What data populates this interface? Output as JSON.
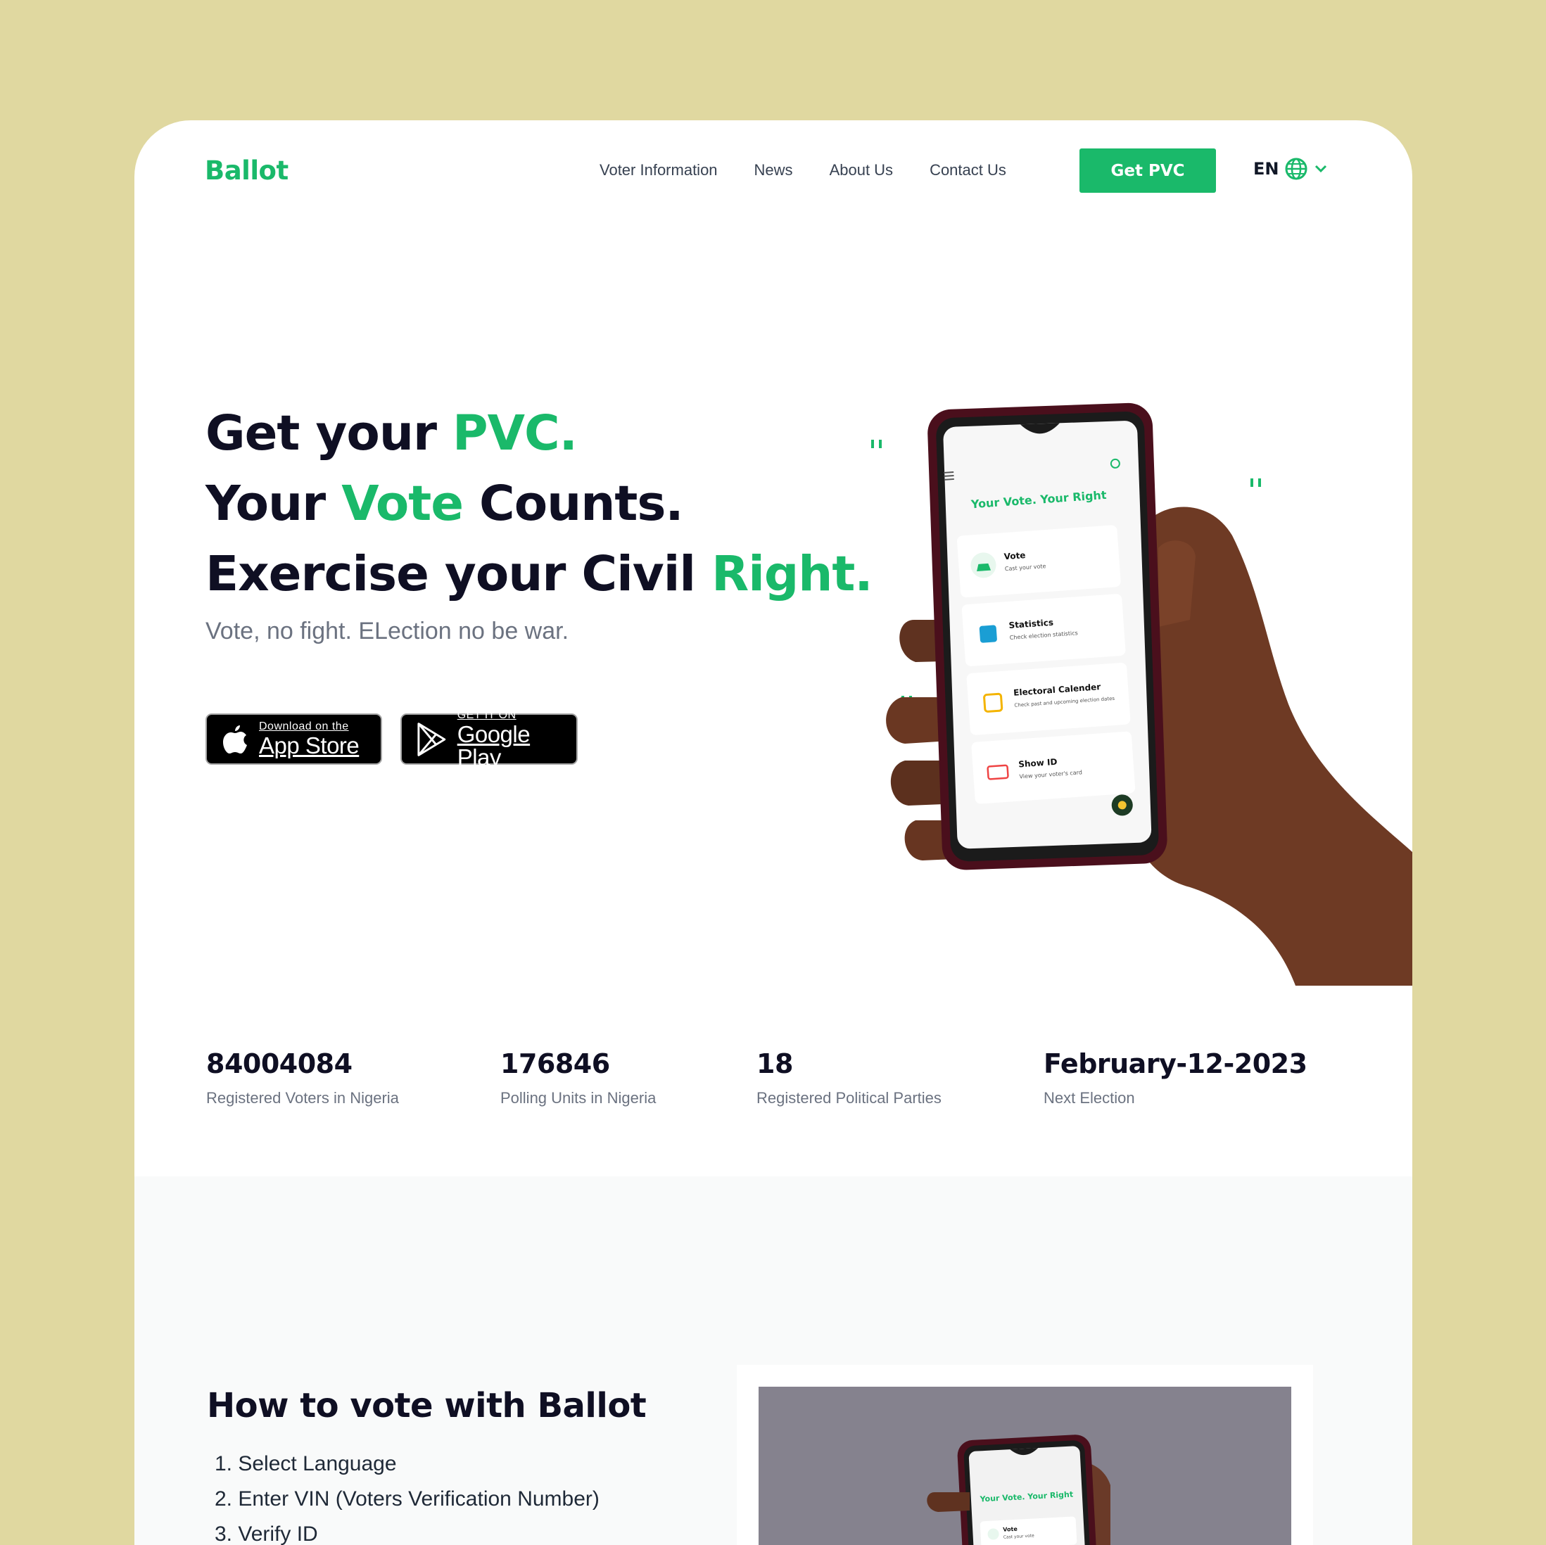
{
  "brand": {
    "name": "Ballot",
    "accent": "#1ab96a",
    "background": "#e0d8a0"
  },
  "nav": {
    "links": [
      "Voter Information",
      "News",
      "About Us",
      "Contact Us"
    ],
    "cta": "Get PVC",
    "language": "EN",
    "language_icon": "globe-icon",
    "dropdown_icon": "chevron-down-icon"
  },
  "hero": {
    "line1": {
      "pre": "Get your ",
      "accent": "PVC."
    },
    "line2": {
      "pre": "Your ",
      "accent": "Vote",
      "post": " Counts."
    },
    "line3": {
      "pre": "Exercise your Civil ",
      "accent": "Right."
    },
    "subtitle": "Vote, no fight. ELection no be war.",
    "appstore": {
      "small": "Download on the",
      "big": "App Store",
      "icon": "apple-icon"
    },
    "googleplay": {
      "small": "GET IT ON",
      "big": "Google Play",
      "icon": "play-icon"
    }
  },
  "phone_app": {
    "heading": "Your Vote. Your Right",
    "menu_icon": "menu-icon",
    "globe_icon": "globe-icon",
    "items": [
      {
        "title": "Vote",
        "desc": "Cast your vote",
        "icon": "ballot-box-icon"
      },
      {
        "title": "Statistics",
        "desc": "Check election statistics",
        "icon": "bar-chart-icon"
      },
      {
        "title": "Electoral Calender",
        "desc": "Check past and upcoming election dates",
        "icon": "calendar-icon"
      },
      {
        "title": "Show ID",
        "desc": "View your voter's card",
        "icon": "id-card-icon"
      }
    ]
  },
  "stats": [
    {
      "value": "84004084",
      "label": "Registered Voters in Nigeria"
    },
    {
      "value": "176846",
      "label": "Polling Units in Nigeria"
    },
    {
      "value": "18",
      "label": "Registered Political Parties"
    },
    {
      "value": "February-12-2023",
      "label": "Next Election"
    }
  ],
  "howto": {
    "title": "How to vote with Ballot",
    "steps": [
      "1. Select Language",
      "2. Enter VIN (Voters Verification Number)",
      "3. Verify ID"
    ],
    "video_heading": "Your Vote. Your Right",
    "video_item": {
      "title": "Vote",
      "desc": "Cast your vote"
    }
  }
}
